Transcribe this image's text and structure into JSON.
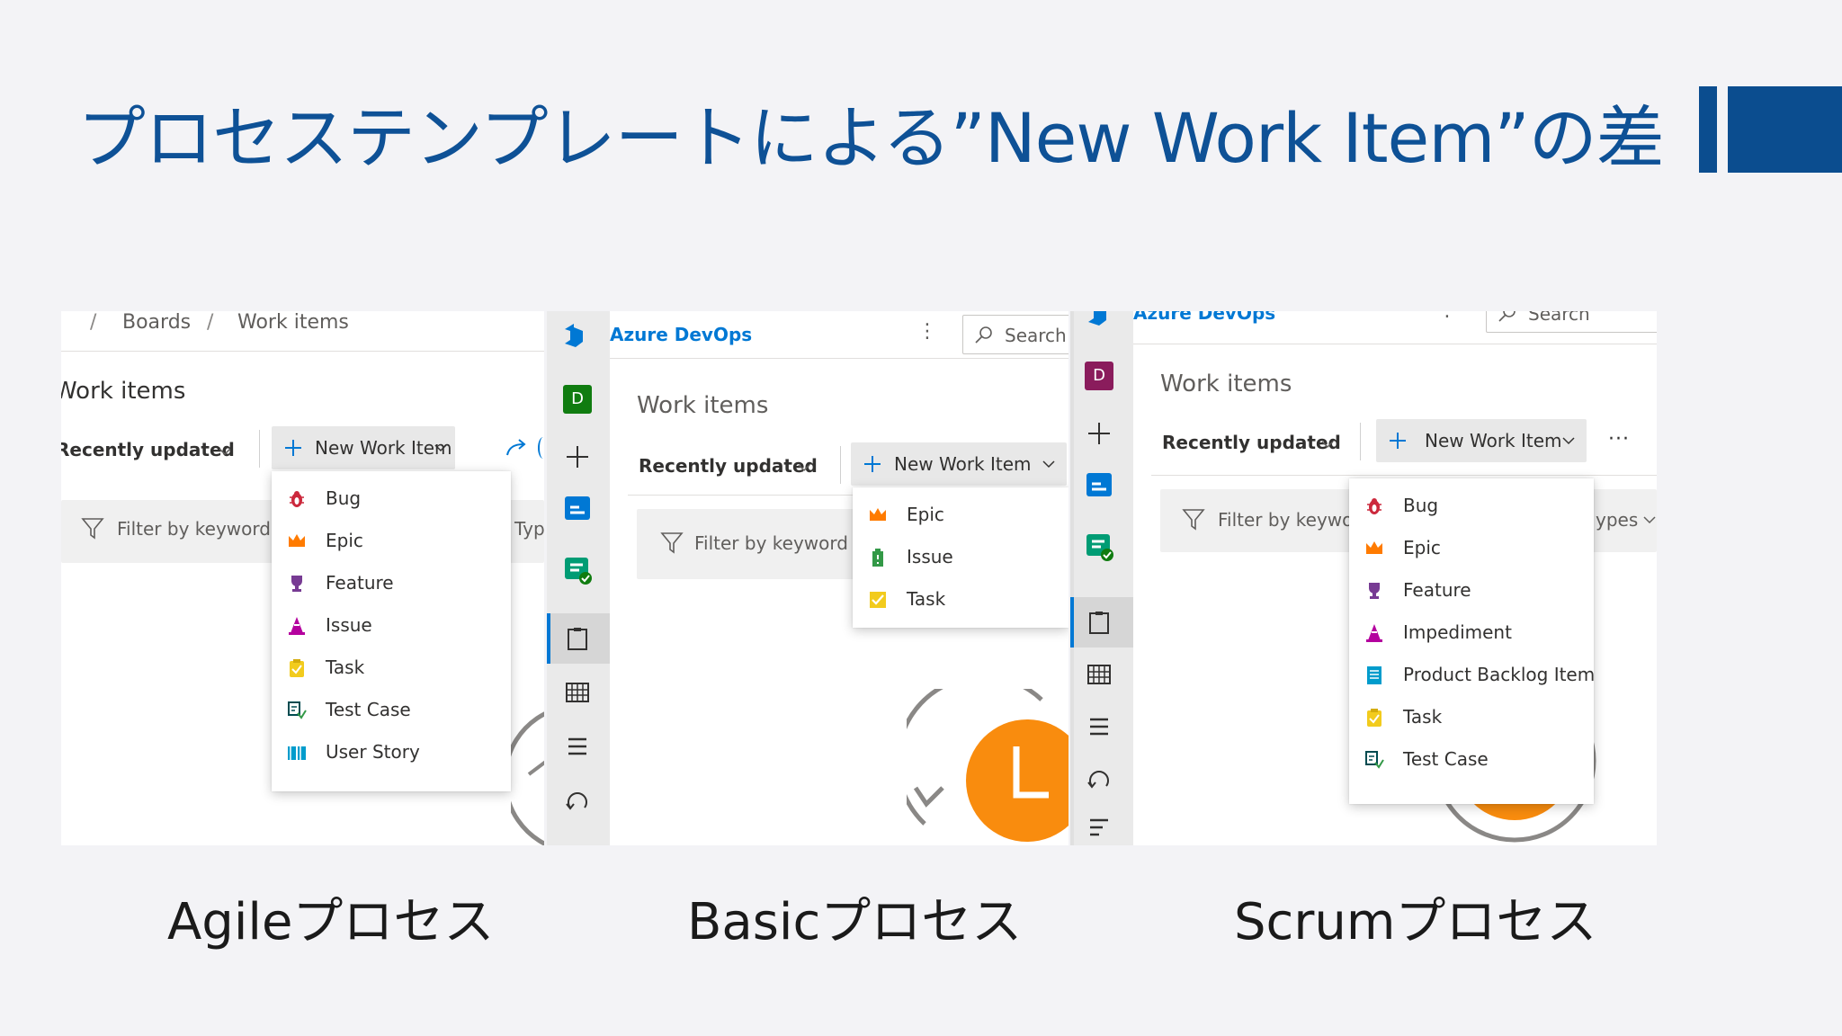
{
  "slide": {
    "title": "プロセステンプレートによる”New Work Item”の差",
    "captions": [
      "Agileプロセス",
      "Basicプロセス",
      "Scrumプロセス"
    ]
  },
  "agile": {
    "breadcrumb_sep1": "/",
    "breadcrumb_boards": "Boards",
    "breadcrumb_sep2": "/",
    "breadcrumb_work_items": "Work items",
    "page_title": "Work items",
    "recently_updated": "Recently updated",
    "new_work_item": "New Work Item",
    "filter_placeholder": "Filter by keyword",
    "types_fragment": "Typ",
    "menu": [
      "Bug",
      "Epic",
      "Feature",
      "Issue",
      "Task",
      "Test Case",
      "User Story"
    ]
  },
  "basic": {
    "brand": "Azure DevOps",
    "search": "Search",
    "avatar": "D",
    "page_title": "Work items",
    "recently_updated": "Recently updated",
    "new_work_item": "New Work Item",
    "filter_placeholder": "Filter by keyword",
    "menu": [
      "Epic",
      "Issue",
      "Task"
    ],
    "clock_letter": "L"
  },
  "scrum": {
    "brand": "Azure DevOps",
    "search": "Search",
    "avatar": "D",
    "page_title": "Work items",
    "recently_updated": "Recently updated",
    "new_work_item": "New Work Item",
    "more": "···",
    "filter_placeholder": "Filter by keywor",
    "types_fragment": "ypes",
    "menu": [
      "Bug",
      "Epic",
      "Feature",
      "Impediment",
      "Product Backlog Item",
      "Task",
      "Test Case"
    ]
  },
  "colors": {
    "title_blue": "#0e5196",
    "azure_blue": "#0078d4",
    "bug": "#cc293d",
    "epic": "#ff7b00",
    "feature": "#773b93",
    "issue_agile": "#b4009e",
    "issue_basic": "#339947",
    "task": "#f2cb1d",
    "test_case": "#004b50",
    "user_story": "#009ccc",
    "pbi": "#009ccc",
    "impediment": "#b4009e",
    "clock_orange": "#f98c0e"
  }
}
